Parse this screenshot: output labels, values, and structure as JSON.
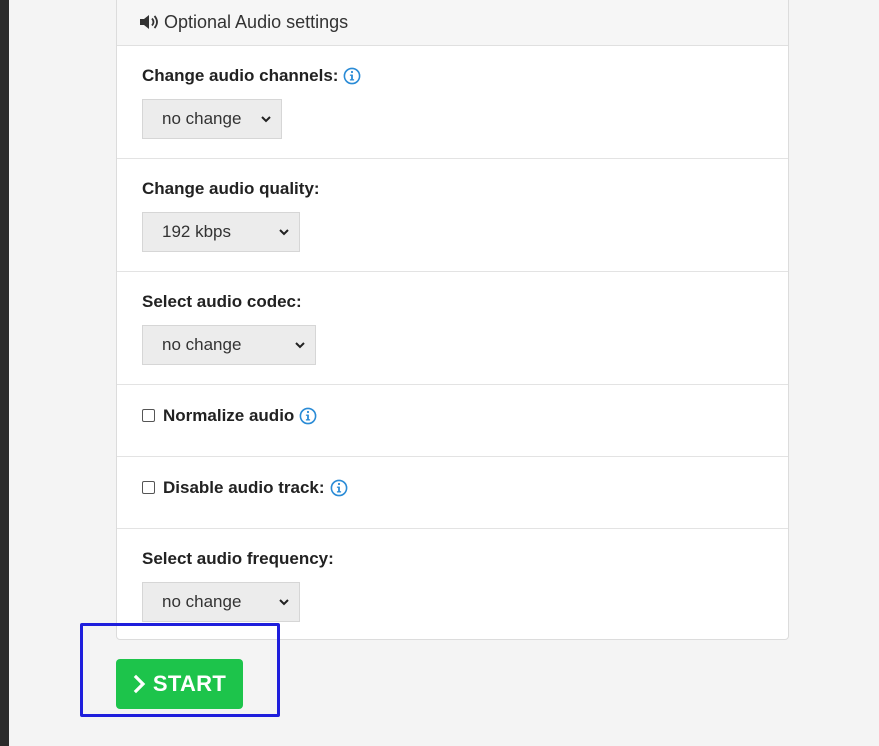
{
  "panel": {
    "title": "Optional Audio settings",
    "icon": "speaker-icon"
  },
  "settings": {
    "channels": {
      "label": "Change audio channels:",
      "value": "no change"
    },
    "quality": {
      "label": "Change audio quality:",
      "value": "192 kbps"
    },
    "codec": {
      "label": "Select audio codec:",
      "value": "no change"
    },
    "normalize": {
      "label": "Normalize audio",
      "checked": false
    },
    "disable_track": {
      "label": "Disable audio track:",
      "checked": false
    },
    "frequency": {
      "label": "Select audio frequency:",
      "value": "no change"
    }
  },
  "start_button": {
    "label": "START"
  },
  "colors": {
    "accent_green": "#1dc44b",
    "info_blue": "#2a8bd6",
    "highlight_blue": "#1e1edc"
  }
}
